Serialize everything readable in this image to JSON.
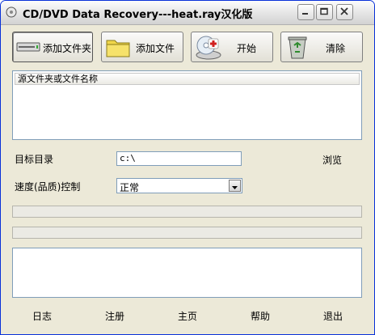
{
  "window": {
    "title": "CD/DVD Data Recovery---heat.ray汉化版"
  },
  "toolbar": {
    "add_folder": "添加文件夹",
    "add_file": "添加文件",
    "start": "开始",
    "clear": "清除"
  },
  "source_list": {
    "column_header": "源文件夹或文件名称"
  },
  "target": {
    "label": "目标目录",
    "value": "c:\\",
    "browse": "浏览"
  },
  "speed": {
    "label": "速度(品质)控制",
    "selected": "正常"
  },
  "bottom_links": {
    "log": "日志",
    "register": "注册",
    "home": "主页",
    "help": "帮助",
    "exit": "退出"
  }
}
